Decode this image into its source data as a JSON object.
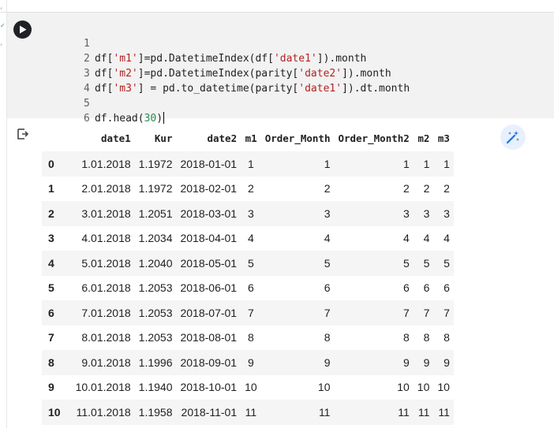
{
  "code_cell": {
    "lines": [
      {
        "n": "1",
        "text": ""
      },
      {
        "n": "2",
        "text": "df['m1']=pd.DatetimeIndex(df['date1']).month"
      },
      {
        "n": "3",
        "text": "df['m2']=pd.DatetimeIndex(parity['date2']).month"
      },
      {
        "n": "4",
        "text": "df['m3'] = pd.to_datetime(parity['date1']).dt.month"
      },
      {
        "n": "5",
        "text": ""
      },
      {
        "n": "6",
        "text": "df.head(30)"
      }
    ]
  },
  "output": {
    "columns": [
      "",
      "date1",
      "Kur",
      "date2",
      "m1",
      "Order_Month",
      "Order_Month2",
      "m2",
      "m3"
    ],
    "rows": [
      [
        "0",
        "1.01.2018",
        "1.1972",
        "2018-01-01",
        "1",
        "1",
        "1",
        "1",
        "1"
      ],
      [
        "1",
        "2.01.2018",
        "1.1972",
        "2018-02-01",
        "2",
        "2",
        "2",
        "2",
        "2"
      ],
      [
        "2",
        "3.01.2018",
        "1.2051",
        "2018-03-01",
        "3",
        "3",
        "3",
        "3",
        "3"
      ],
      [
        "3",
        "4.01.2018",
        "1.2034",
        "2018-04-01",
        "4",
        "4",
        "4",
        "4",
        "4"
      ],
      [
        "4",
        "5.01.2018",
        "1.2040",
        "2018-05-01",
        "5",
        "5",
        "5",
        "5",
        "5"
      ],
      [
        "5",
        "6.01.2018",
        "1.2053",
        "2018-06-01",
        "6",
        "6",
        "6",
        "6",
        "6"
      ],
      [
        "6",
        "7.01.2018",
        "1.2053",
        "2018-07-01",
        "7",
        "7",
        "7",
        "7",
        "7"
      ],
      [
        "7",
        "8.01.2018",
        "1.2053",
        "2018-08-01",
        "8",
        "8",
        "8",
        "8",
        "8"
      ],
      [
        "8",
        "9.01.2018",
        "1.1996",
        "2018-09-01",
        "9",
        "9",
        "9",
        "9",
        "9"
      ],
      [
        "9",
        "10.01.2018",
        "1.1940",
        "2018-10-01",
        "10",
        "10",
        "10",
        "10",
        "10"
      ],
      [
        "10",
        "11.01.2018",
        "1.1958",
        "2018-11-01",
        "11",
        "11",
        "11",
        "11",
        "11"
      ]
    ]
  },
  "icons": {
    "run": "play-icon",
    "output": "output-arrow-icon",
    "magic": "magic-wand-icon"
  },
  "colors": {
    "cell_bg": "#f2f2f2",
    "string": "#b22222",
    "number": "#2e8b57",
    "stripe": "#f5f5f5",
    "magic_bg": "#e8f0fe",
    "magic_fg": "#1a73e8"
  }
}
